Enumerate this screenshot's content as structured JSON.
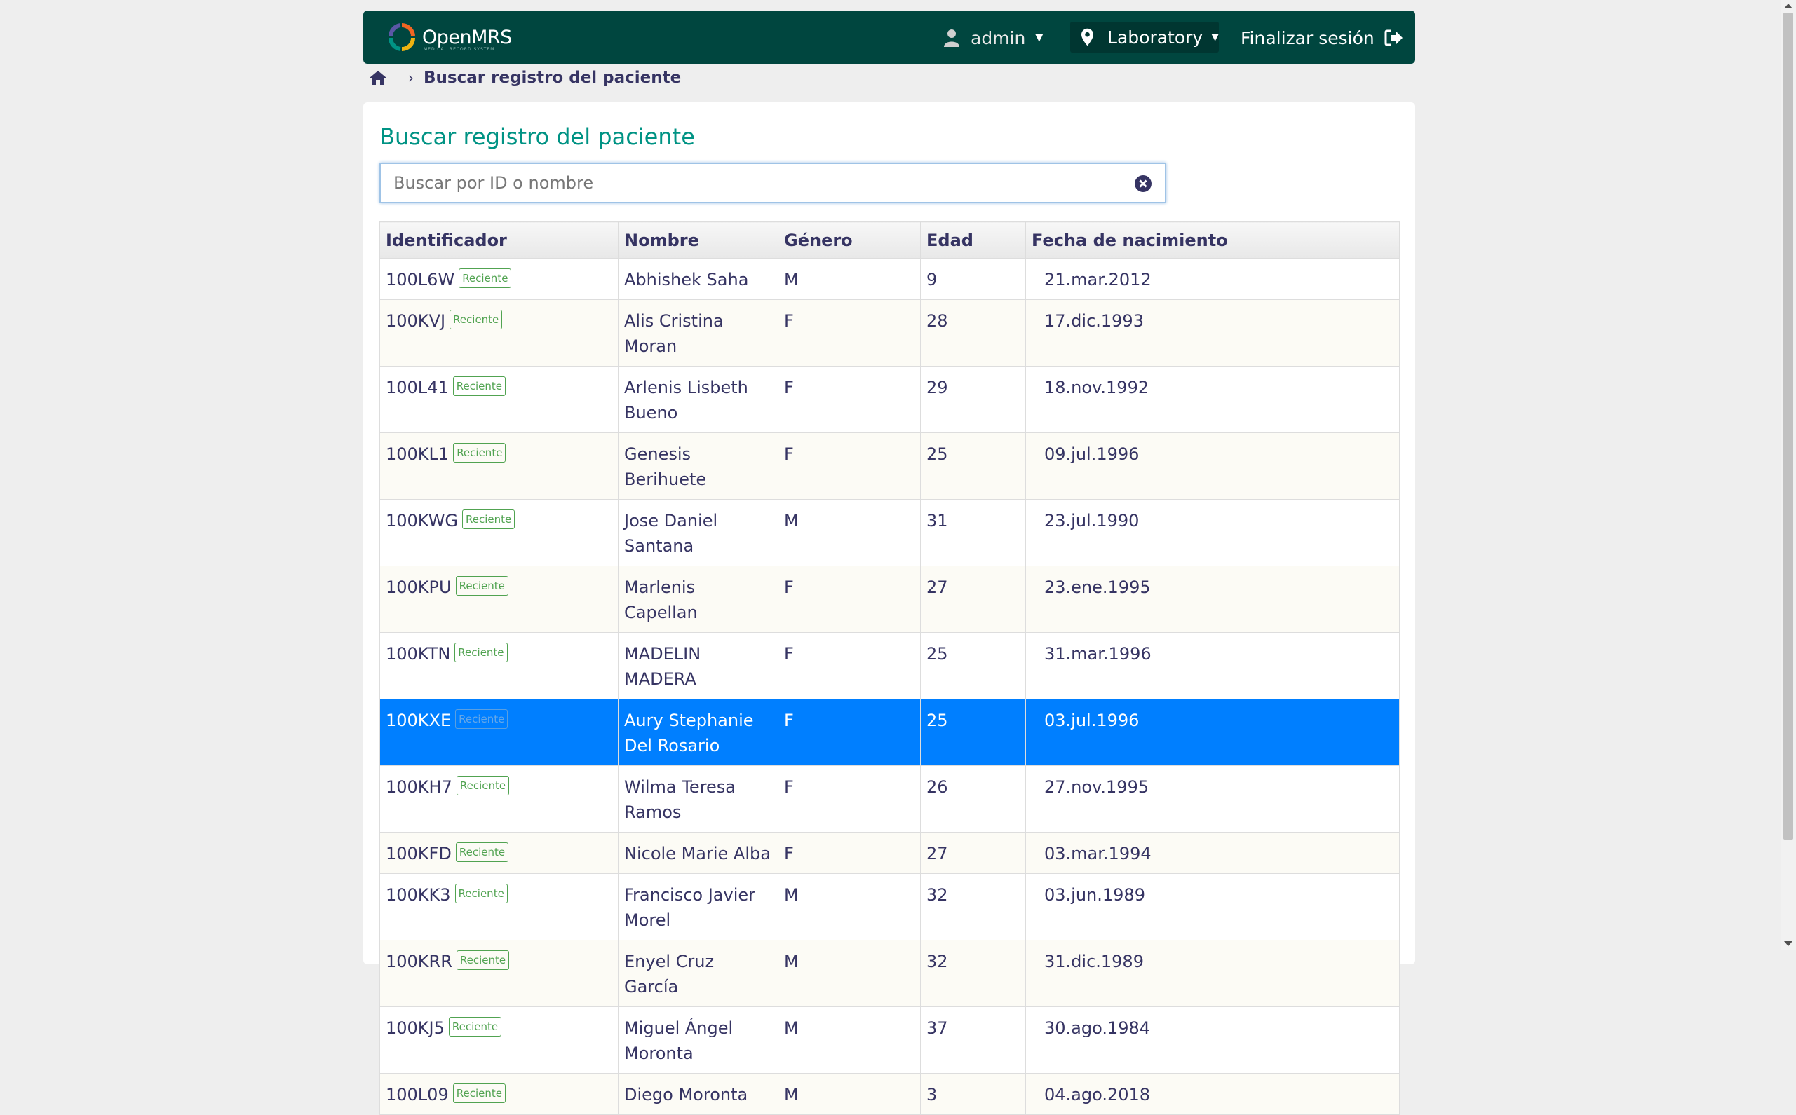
{
  "app": {
    "logo_text": "OpenMRS",
    "logo_subtext": "MEDICAL RECORD SYSTEM"
  },
  "header": {
    "user_label": "admin",
    "location_label": "Laboratory",
    "logout_label": "Finalizar sesión"
  },
  "breadcrumb": {
    "current": "Buscar registro del paciente"
  },
  "page": {
    "title": "Buscar registro del paciente"
  },
  "search": {
    "placeholder": "Buscar por ID o nombre",
    "value": ""
  },
  "table": {
    "columns": [
      "Identificador",
      "Nombre",
      "Género",
      "Edad",
      "Fecha de nacimiento"
    ],
    "badge_label": "Reciente",
    "rows": [
      {
        "id": "100L6W",
        "name": "Abhishek Saha",
        "gender": "M",
        "age": "9",
        "dob": "21.mar.2012"
      },
      {
        "id": "100KVJ",
        "name": "Alis Cristina Moran",
        "gender": "F",
        "age": "28",
        "dob": "17.dic.1993"
      },
      {
        "id": "100L41",
        "name": "Arlenis Lisbeth Bueno",
        "gender": "F",
        "age": "29",
        "dob": "18.nov.1992"
      },
      {
        "id": "100KL1",
        "name": "Genesis Berihuete",
        "gender": "F",
        "age": "25",
        "dob": "09.jul.1996"
      },
      {
        "id": "100KWG",
        "name": "Jose Daniel Santana",
        "gender": "M",
        "age": "31",
        "dob": "23.jul.1990"
      },
      {
        "id": "100KPU",
        "name": "Marlenis Capellan",
        "gender": "F",
        "age": "27",
        "dob": "23.ene.1995"
      },
      {
        "id": "100KTN",
        "name": "MADELIN MADERA",
        "gender": "F",
        "age": "25",
        "dob": "31.mar.1996"
      },
      {
        "id": "100KXE",
        "name": "Aury Stephanie Del Rosario",
        "gender": "F",
        "age": "25",
        "dob": "03.jul.1996",
        "selected": true
      },
      {
        "id": "100KH7",
        "name": "Wilma Teresa Ramos",
        "gender": "F",
        "age": "26",
        "dob": "27.nov.1995"
      },
      {
        "id": "100KFD",
        "name": "Nicole Marie Alba",
        "gender": "F",
        "age": "27",
        "dob": "03.mar.1994"
      },
      {
        "id": "100KK3",
        "name": "Francisco Javier Morel",
        "gender": "M",
        "age": "32",
        "dob": "03.jun.1989"
      },
      {
        "id": "100KRR",
        "name": "Enyel Cruz García",
        "gender": "M",
        "age": "32",
        "dob": "31.dic.1989"
      },
      {
        "id": "100KJ5",
        "name": "Miguel Ángel Moronta",
        "gender": "M",
        "age": "37",
        "dob": "30.ago.1984"
      },
      {
        "id": "100L09",
        "name": "Diego Moronta",
        "gender": "M",
        "age": "3",
        "dob": "04.ago.2018"
      }
    ]
  },
  "colors": {
    "header_bg": "#00463f",
    "title_teal": "#009384",
    "selected_row": "#007fff",
    "badge_green": "#51a351"
  }
}
